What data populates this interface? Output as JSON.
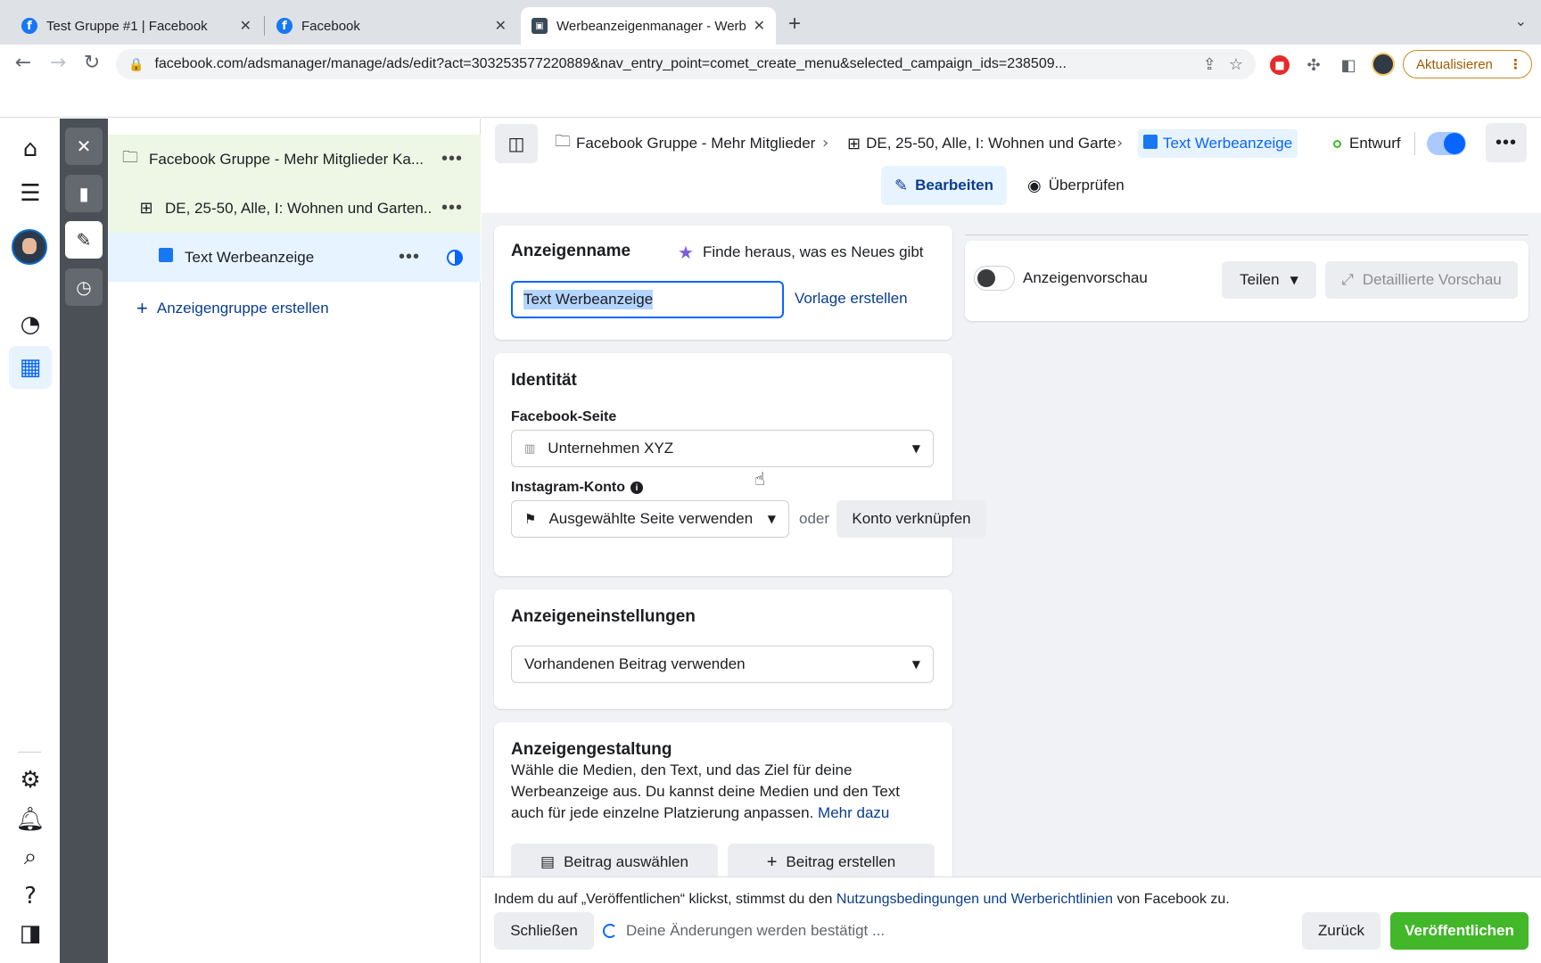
{
  "browser": {
    "tabs": [
      {
        "label": "Test Gruppe #1 | Facebook",
        "icon": "facebook-icon"
      },
      {
        "label": "Facebook",
        "icon": "facebook-icon"
      },
      {
        "label": "Werbeanzeigenmanager - Werb",
        "icon": "ads-manager-icon"
      }
    ],
    "url": "facebook.com/adsmanager/manage/ads/edit?act=303253577220889&nav_entry_point=comet_create_menu&selected_campaign_ids=238509...",
    "update_label": "Aktualisieren"
  },
  "tree": {
    "campaign_label": "Facebook Gruppe - Mehr Mitglieder Ka...",
    "adset_label": "DE, 25-50, Alle, I: Wohnen und Garten...",
    "ad_label": "Text Werbeanzeige",
    "add_adset_label": "Anzeigengruppe erstellen"
  },
  "breadcrumb": {
    "campaign": "Facebook Gruppe - Mehr Mitglieder",
    "adset": "DE, 25-50, Alle, I: Wohnen und Garte",
    "ad": "Text Werbeanzeige"
  },
  "status": {
    "label": "Entwurf",
    "active": true
  },
  "mode_tabs": {
    "edit": "Bearbeiten",
    "review": "Überprüfen"
  },
  "ad_name_card": {
    "title": "Anzeigenname",
    "whats_new": "Finde heraus, was es Neues gibt",
    "name_value": "Text Werbeanzeige",
    "template_link": "Vorlage erstellen"
  },
  "identity_card": {
    "title": "Identität",
    "fb_page_label": "Facebook-Seite",
    "fb_page_value": "Unternehmen XYZ",
    "ig_label": "Instagram-Konto",
    "ig_value": "Ausgewählte Seite verwenden",
    "or_label": "oder",
    "link_account": "Konto verknüpfen"
  },
  "settings_card": {
    "title": "Anzeigeneinstellungen",
    "value": "Vorhandenen Beitrag verwenden"
  },
  "creative_card": {
    "title": "Anzeigengestaltung",
    "description": "Wähle die Medien, den Text, und das Ziel für deine Werbeanzeige aus. Du kannst deine Medien und den Text auch für jede einzelne Platzierung anpassen.",
    "more_link": "Mehr dazu",
    "select_post": "Beitrag auswählen",
    "create_post": "Beitrag erstellen"
  },
  "preview": {
    "label": "Anzeigenvorschau",
    "share": "Teilen",
    "detailed": "Detaillierte Vorschau"
  },
  "footer": {
    "legal_prefix": "Indem du auf „Veröffentlichen“ klickst, stimmst du den ",
    "legal_link": "Nutzungsbedingungen und Werberichtlinien",
    "legal_suffix": " von Facebook zu.",
    "close": "Schließen",
    "saving": "Deine Änderungen werden bestätigt ...",
    "back": "Zurück",
    "publish": "Veröffentlichen"
  },
  "colors": {
    "primary": "#0866ff",
    "publish_green": "#42b72a",
    "link": "#0a3d8f"
  }
}
